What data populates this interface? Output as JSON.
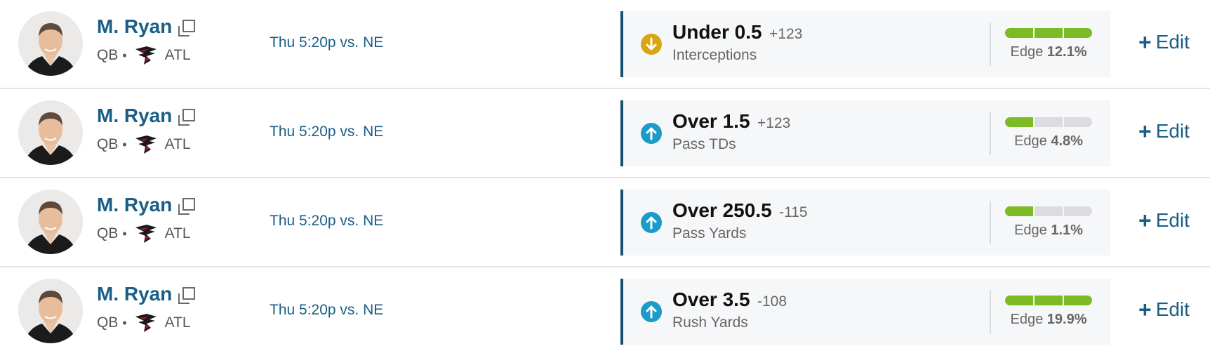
{
  "rows": [
    {
      "player": {
        "name": "M. Ryan",
        "position": "QB",
        "team": "ATL"
      },
      "game": "Thu 5:20p vs. NE",
      "pick": {
        "direction": "down",
        "line": "Under 0.5",
        "odds": "+123",
        "stat": "Interceptions"
      },
      "edge": {
        "label": "Edge",
        "value": "12.1%",
        "level": 3
      },
      "edit_label": "Edit"
    },
    {
      "player": {
        "name": "M. Ryan",
        "position": "QB",
        "team": "ATL"
      },
      "game": "Thu 5:20p vs. NE",
      "pick": {
        "direction": "up",
        "line": "Over 1.5",
        "odds": "+123",
        "stat": "Pass TDs"
      },
      "edge": {
        "label": "Edge",
        "value": "4.8%",
        "level": 1
      },
      "edit_label": "Edit"
    },
    {
      "player": {
        "name": "M. Ryan",
        "position": "QB",
        "team": "ATL"
      },
      "game": "Thu 5:20p vs. NE",
      "pick": {
        "direction": "up",
        "line": "Over 250.5",
        "odds": "-115",
        "stat": "Pass Yards"
      },
      "edge": {
        "label": "Edge",
        "value": "1.1%",
        "level": 1
      },
      "edit_label": "Edit"
    },
    {
      "player": {
        "name": "M. Ryan",
        "position": "QB",
        "team": "ATL"
      },
      "game": "Thu 5:20p vs. NE",
      "pick": {
        "direction": "up",
        "line": "Over 3.5",
        "odds": "-108",
        "stat": "Rush Yards"
      },
      "edge": {
        "label": "Edge",
        "value": "19.9%",
        "level": 3
      },
      "edit_label": "Edit"
    }
  ],
  "icons": {
    "player_link": "external-link-icon",
    "team_logo": "falcons-logo-icon",
    "under": "arrow-down-circle-icon",
    "over": "arrow-up-circle-icon",
    "edit": "plus-icon"
  },
  "colors": {
    "link": "#1a5e86",
    "under": "#d9a511",
    "over": "#1a9bc9",
    "edge_fill": "#7cbb25",
    "edge_empty": "#dcdcde",
    "pick_accent": "#174f6e"
  }
}
